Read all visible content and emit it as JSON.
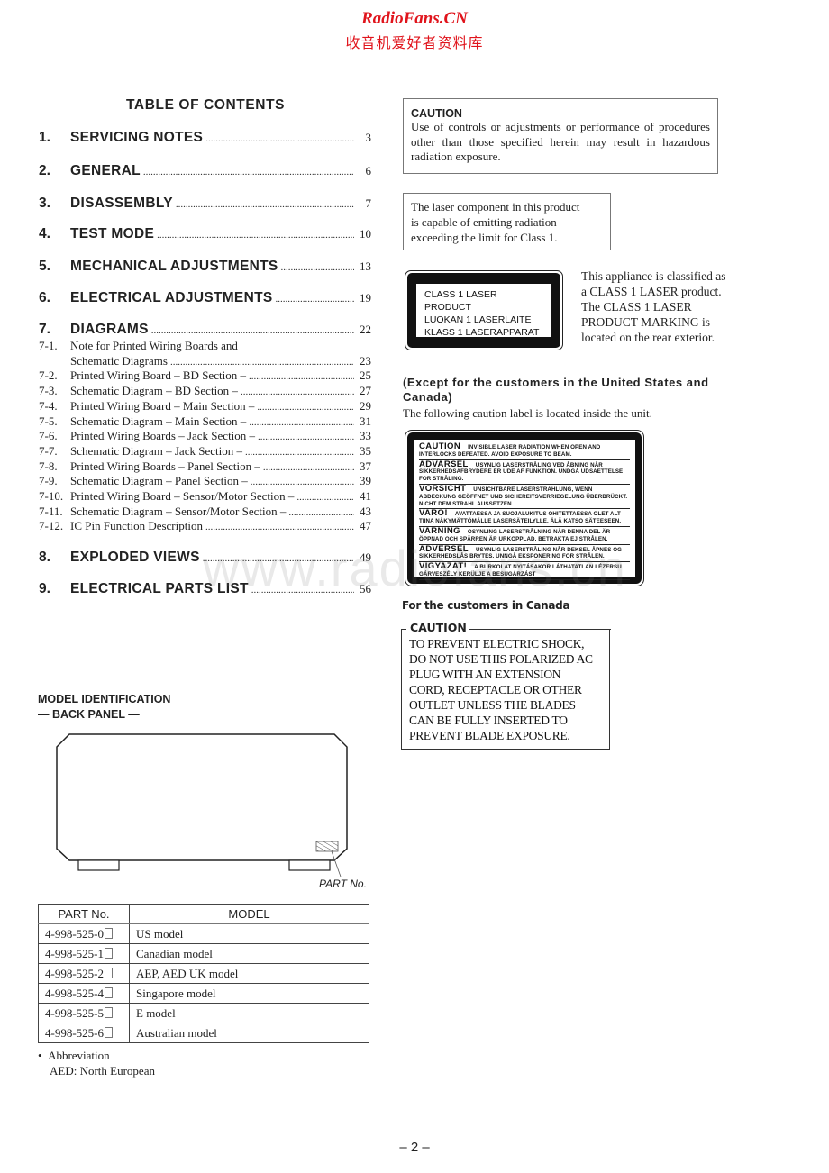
{
  "header": {
    "site_name": "RadioFans.CN",
    "site_subtitle": "收音机爱好者资料库"
  },
  "watermark": "www.radiofans.cn",
  "toc": {
    "title": "TABLE  OF  CONTENTS",
    "main_entries": [
      {
        "num": "1.",
        "label": "SERVICING  NOTES",
        "page": "3"
      },
      {
        "num": "2.",
        "label": "GENERAL",
        "page": "6"
      },
      {
        "num": "3.",
        "label": "DISASSEMBLY",
        "page": "7"
      },
      {
        "num": "4.",
        "label": "TEST  MODE",
        "page": "10"
      },
      {
        "num": "5.",
        "label": "MECHANICAL  ADJUSTMENTS",
        "page": "13"
      },
      {
        "num": "6.",
        "label": "ELECTRICAL  ADJUSTMENTS",
        "page": "19"
      },
      {
        "num": "7.",
        "label": "DIAGRAMS",
        "page": "22"
      },
      {
        "num": "8.",
        "label": "EXPLODED  VIEWS",
        "page": "49"
      },
      {
        "num": "9.",
        "label": "ELECTRICAL  PARTS  LIST",
        "page": "56"
      }
    ],
    "sub_entries": [
      {
        "num": "7-1.",
        "label": "Note for Printed Wiring Boards and",
        "page": ""
      },
      {
        "num": "",
        "label": "Schematic Diagrams",
        "page": "23"
      },
      {
        "num": "7-2.",
        "label": "Printed Wiring Board  – BD Section –",
        "page": "25"
      },
      {
        "num": "7-3.",
        "label": "Schematic Diagram – BD Section –",
        "page": "27"
      },
      {
        "num": "7-4.",
        "label": "Printed Wiring Board  – Main Section –",
        "page": "29"
      },
      {
        "num": "7-5.",
        "label": "Schematic Diagram  – Main Section –",
        "page": "31"
      },
      {
        "num": "7-6.",
        "label": "Printed Wiring Boards  – Jack Section –",
        "page": "33"
      },
      {
        "num": "7-7.",
        "label": "Schematic Diagram  – Jack Section –",
        "page": "35"
      },
      {
        "num": "7-8.",
        "label": "Printed Wiring Boards  – Panel Section –",
        "page": "37"
      },
      {
        "num": "7-9.",
        "label": "Schematic Diagram  – Panel Section –",
        "page": "39"
      },
      {
        "num": "7-10.",
        "label": "Printed Wiring Board  – Sensor/Motor Section –",
        "page": "41"
      },
      {
        "num": "7-11.",
        "label": "Schematic Diagram  – Sensor/Motor Section –",
        "page": "43"
      },
      {
        "num": "7-12.",
        "label": "IC Pin Function Description",
        "page": "47"
      }
    ]
  },
  "caution": {
    "heading": "CAUTION",
    "text": "Use of controls or adjustments or performance of procedures other than those specified herein may result in hazardous radiation exposure."
  },
  "laser_notice": {
    "lines": [
      "The laser component in this product",
      "is capable of emitting radiation",
      "exceeding the limit for Class 1."
    ]
  },
  "class1_label": {
    "lines": [
      "CLASS 1 LASER PRODUCT",
      "LUOKAN 1 LASERLAITE",
      "KLASS 1 LASERAPPARAT"
    ]
  },
  "class1_description": {
    "lines": [
      "This appliance is classified as",
      "a CLASS 1 LASER product.",
      "The CLASS 1 LASER",
      "PRODUCT MARKING is",
      "located on the rear exterior."
    ]
  },
  "except_section": {
    "title": "(Except for the customers in the United States and Canada)",
    "text": "The following caution label is located inside the unit."
  },
  "warning_label": {
    "rows": [
      {
        "heading": "CAUTION",
        "text": "INVISIBLE  LASER  RADIATION  WHEN  OPEN  AND INTERLOCKS  DEFEATED.  AVOID  EXPOSURE  TO  BEAM."
      },
      {
        "heading": "ADVARSEL",
        "text": "USYNLIG  LASERSTRÅLING  VED  ÅBNING  NÅR SIKKERHEDSAFBRYDERE ER UDE AF FUNKTION. UNDGÅ UDSAETTELSE FOR STRÅLING."
      },
      {
        "heading": "VORSICHT",
        "text": "UNSICHTBARE  LASERSTRAHLUNG,  WENN ABDECKUNG  GEÖFFNET  UND  SICHEREITSVERRIEGELUNG ÜBERBRÜCKT.  NICHT  DEM  STRAHL  AUSSETZEN."
      },
      {
        "heading": "VARO!",
        "text": "AVATTAESSA JA SUOJALUKITUS OHITETTAESSA OLET ALT TIINA  NÄKYMÄTTÖMÄLLE  LASERSÄTEILYLLE.  ÄLÄ  KATSO  SÄTEESEEN."
      },
      {
        "heading": "VARNING",
        "text": "OSYNLING LASERSTRÅLNING NÄR DENNA DEL ÄR ÖPPNAD OCH SPÄRREN ÄR URKOPPLAD. BETRAKTA EJ STRÅLEN."
      },
      {
        "heading": "ADVERSEL",
        "text": "USYNLIG  LASERSTRÅLING  NÅR  DEKSEL  ÅPNES  OG SIKKERHEDSLÅS BRYTES.  UNNGÅ EKSPONERING FOR STRÅLEN."
      },
      {
        "heading": "VIGYAZAT!",
        "text": "A  BURKOLAT  NYITÁSAKOR  LÁTHATATLAN  LÉZERSU GÁRVESZÉLY   KERÜLJE  A  BESUGÁRZÁST"
      }
    ]
  },
  "canada_section": {
    "title": "For the customers in Canada",
    "heading": "CAUTION",
    "lines": [
      "TO PREVENT ELECTRIC SHOCK,",
      "DO NOT USE THIS POLARIZED AC",
      "PLUG WITH AN EXTENSION",
      "CORD, RECEPTACLE OR OTHER",
      "OUTLET UNLESS THE BLADES",
      "CAN BE FULLY INSERTED TO",
      "PREVENT BLADE EXPOSURE."
    ]
  },
  "model_identification": {
    "title": "MODEL IDENTIFICATION",
    "subtitle": "— BACK PANEL —",
    "part_no_callout": "PART No.",
    "table": {
      "headers": [
        "PART No.",
        "MODEL"
      ],
      "rows": [
        {
          "part": "4-998-525-0",
          "model": "US model"
        },
        {
          "part": "4-998-525-1",
          "model": "Canadian model"
        },
        {
          "part": "4-998-525-2",
          "model": "AEP, AED UK model"
        },
        {
          "part": "4-998-525-4",
          "model": "Singapore model"
        },
        {
          "part": "4-998-525-5",
          "model": "E model"
        },
        {
          "part": "4-998-525-6",
          "model": "Australian model"
        }
      ]
    },
    "abbreviation_label": "Abbreviation",
    "abbreviation_text": "AED:  North European"
  },
  "page_number": "– 2 –"
}
